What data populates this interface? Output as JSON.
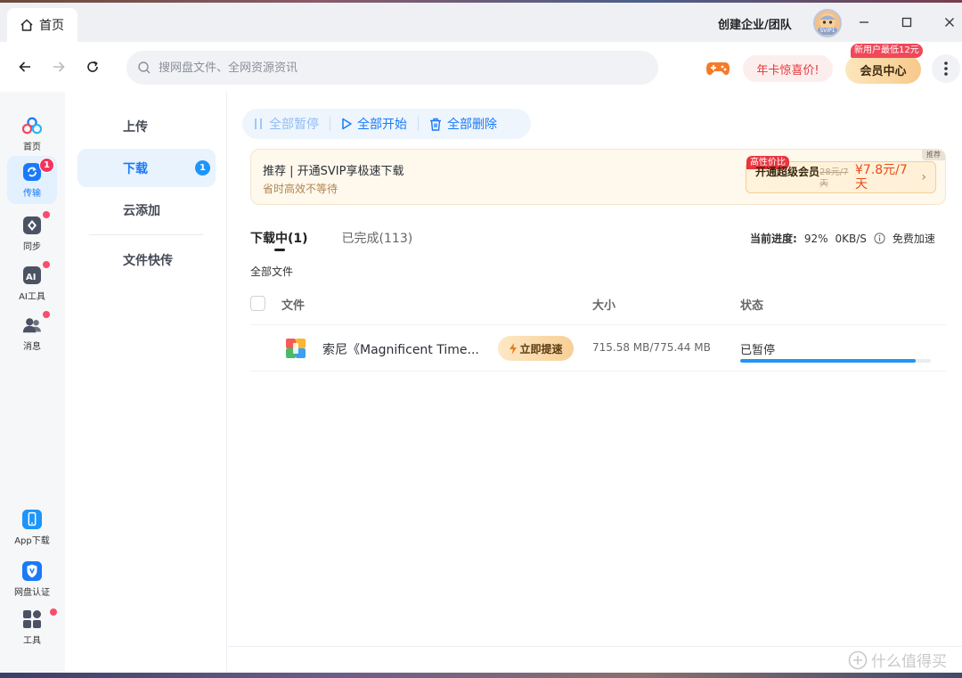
{
  "window": {
    "tab_title": "首页",
    "create_team": "创建企业/团队",
    "avatar_badge": "SVIP1"
  },
  "nav": {
    "search_placeholder": "搜网盘文件、全网资源资讯",
    "year_card": "年卡惊喜价!",
    "vip_center": "会员中心",
    "new_user_tag": "新用户最低12元"
  },
  "rail": {
    "items": [
      {
        "label": "首页",
        "icon": "home-cloud-icon"
      },
      {
        "label": "传输",
        "icon": "transfer-icon",
        "badge": "1"
      },
      {
        "label": "同步",
        "icon": "sync-icon"
      },
      {
        "label": "AI工具",
        "icon": "ai-tools-icon"
      },
      {
        "label": "消息",
        "icon": "message-icon"
      }
    ],
    "bottom": [
      {
        "label": "App下载",
        "icon": "phone-icon"
      },
      {
        "label": "网盘认证",
        "icon": "verify-icon"
      },
      {
        "label": "工具",
        "icon": "grid-icon"
      }
    ]
  },
  "submenu": {
    "items": [
      {
        "label": "上传"
      },
      {
        "label": "下载",
        "badge": "1"
      },
      {
        "label": "云添加"
      },
      {
        "label": "文件快传"
      }
    ]
  },
  "toolbar": {
    "pause_all": "全部暂停",
    "start_all": "全部开始",
    "delete_all": "全部删除"
  },
  "promo": {
    "title": "推荐 | 开通SVIP享极速下载",
    "subtitle": "省时高效不等待",
    "tag": "推荐",
    "hot": "高性价比",
    "name": "开通超级会员",
    "old_price": "28元/7天",
    "new_price": "¥7.8元/7天",
    "arrow": "›"
  },
  "tabs": {
    "downloading": "下载中(1)",
    "completed": "已完成(113)"
  },
  "progress": {
    "label": "当前进度:",
    "percent": "92%",
    "speed": "0KB/S",
    "free_boost": "免费加速"
  },
  "list": {
    "all_files": "全部文件",
    "headers": {
      "file": "文件",
      "size": "大小",
      "status": "状态"
    },
    "rows": [
      {
        "name": "索尼《Magnificent Time...",
        "speedup": "立即提速",
        "size": "715.58 MB/775.44 MB",
        "status": "已暂停",
        "progress": 0.92
      }
    ]
  },
  "watermark": "什么值得买",
  "colors": {
    "accent": "#1a7af8",
    "badge": "#f5325d",
    "progress": "#1e95f8"
  }
}
